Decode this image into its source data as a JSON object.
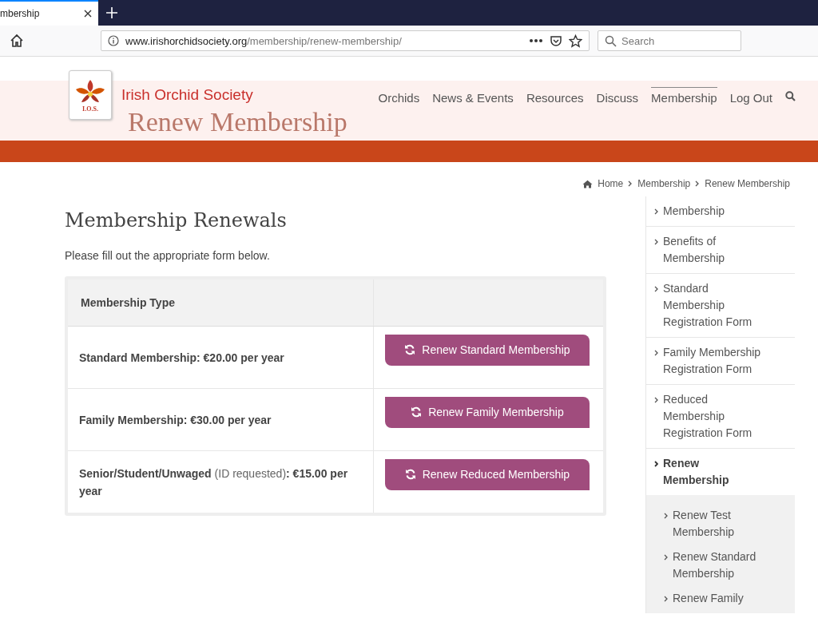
{
  "browser": {
    "tab_title": "mbership",
    "url_domain": "www.irishorchidsociety.org",
    "url_path": "/membership/renew-membership/",
    "search_placeholder": "Search"
  },
  "site": {
    "name": "Irish Orchid Society",
    "logo_text": "I.O.S.",
    "nav": [
      {
        "label": "Orchids",
        "selected": false
      },
      {
        "label": "News & Events",
        "selected": false
      },
      {
        "label": "Resources",
        "selected": false
      },
      {
        "label": "Discuss",
        "selected": false
      },
      {
        "label": "Membership",
        "selected": true
      },
      {
        "label": "Log Out",
        "selected": false
      }
    ],
    "banner_title": "Renew Membership"
  },
  "breadcrumb": [
    "Home",
    "Membership",
    "Renew Membership"
  ],
  "heading": "Membership Renewals",
  "intro": "Please fill out the appropriate form below.",
  "table": {
    "columns": [
      "Membership Type"
    ],
    "rows": [
      {
        "label": "Standard Membership: €20.00 per year",
        "button": "Renew Standard Membership"
      },
      {
        "label": "Family Membership: €30.00 per year",
        "button": "Renew Family Membership"
      },
      {
        "label": "Senior/Student/Unwaged",
        "note": "(ID requested)",
        "suffix": ": €15.00 per year",
        "button": "Renew Reduced Membership"
      }
    ]
  },
  "sidebar": {
    "items": [
      {
        "label": "Membership",
        "selected": false
      },
      {
        "label": "Benefits of Membership",
        "selected": false
      },
      {
        "label": "Standard Membership Registration Form",
        "selected": false
      },
      {
        "label": "Family Membership Registration Form",
        "selected": false
      },
      {
        "label": "Reduced Membership Registration Form",
        "selected": false
      },
      {
        "label": "Renew Membership",
        "selected": true,
        "children": [
          {
            "label": "Renew Test Membership",
            "selected": false
          },
          {
            "label": "Renew Standard Membership",
            "selected": false
          },
          {
            "label": "Renew Family",
            "selected": false
          }
        ]
      }
    ]
  }
}
